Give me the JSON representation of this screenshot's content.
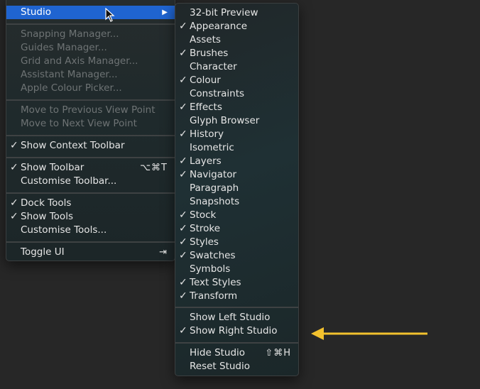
{
  "main_menu": {
    "studio": "Studio",
    "group1": [
      "Snapping Manager...",
      "Guides Manager...",
      "Grid and Axis Manager...",
      "Assistant Manager...",
      "Apple Colour Picker..."
    ],
    "group2": [
      "Move to Previous View Point",
      "Move to Next View Point"
    ],
    "context_toolbar": "Show Context Toolbar",
    "show_toolbar": "Show Toolbar",
    "show_toolbar_shortcut": "⌥⌘T",
    "customise_toolbar": "Customise Toolbar...",
    "dock_tools": "Dock Tools",
    "show_tools": "Show Tools",
    "customise_tools": "Customise Tools...",
    "toggle_ui": "Toggle UI",
    "toggle_ui_shortcut": "⇥"
  },
  "studio_menu": {
    "panels": [
      {
        "label": "32-bit Preview",
        "checked": false
      },
      {
        "label": "Appearance",
        "checked": true
      },
      {
        "label": "Assets",
        "checked": false
      },
      {
        "label": "Brushes",
        "checked": true
      },
      {
        "label": "Character",
        "checked": false
      },
      {
        "label": "Colour",
        "checked": true
      },
      {
        "label": "Constraints",
        "checked": false
      },
      {
        "label": "Effects",
        "checked": true
      },
      {
        "label": "Glyph Browser",
        "checked": false
      },
      {
        "label": "History",
        "checked": true
      },
      {
        "label": "Isometric",
        "checked": false
      },
      {
        "label": "Layers",
        "checked": true
      },
      {
        "label": "Navigator",
        "checked": true
      },
      {
        "label": "Paragraph",
        "checked": false
      },
      {
        "label": "Snapshots",
        "checked": false
      },
      {
        "label": "Stock",
        "checked": true
      },
      {
        "label": "Stroke",
        "checked": true
      },
      {
        "label": "Styles",
        "checked": true
      },
      {
        "label": "Swatches",
        "checked": true
      },
      {
        "label": "Symbols",
        "checked": false
      },
      {
        "label": "Text Styles",
        "checked": true
      },
      {
        "label": "Transform",
        "checked": true
      }
    ],
    "show_left_studio": "Show Left Studio",
    "show_right_studio": "Show Right Studio",
    "hide_studio": "Hide Studio",
    "hide_studio_shortcut": "⇧⌘H",
    "reset_studio": "Reset Studio"
  },
  "checkmark": "✓",
  "submenu_arrow": "▶",
  "colors": {
    "highlight": "#1f64d0",
    "annotation_arrow": "#f2c12e"
  }
}
